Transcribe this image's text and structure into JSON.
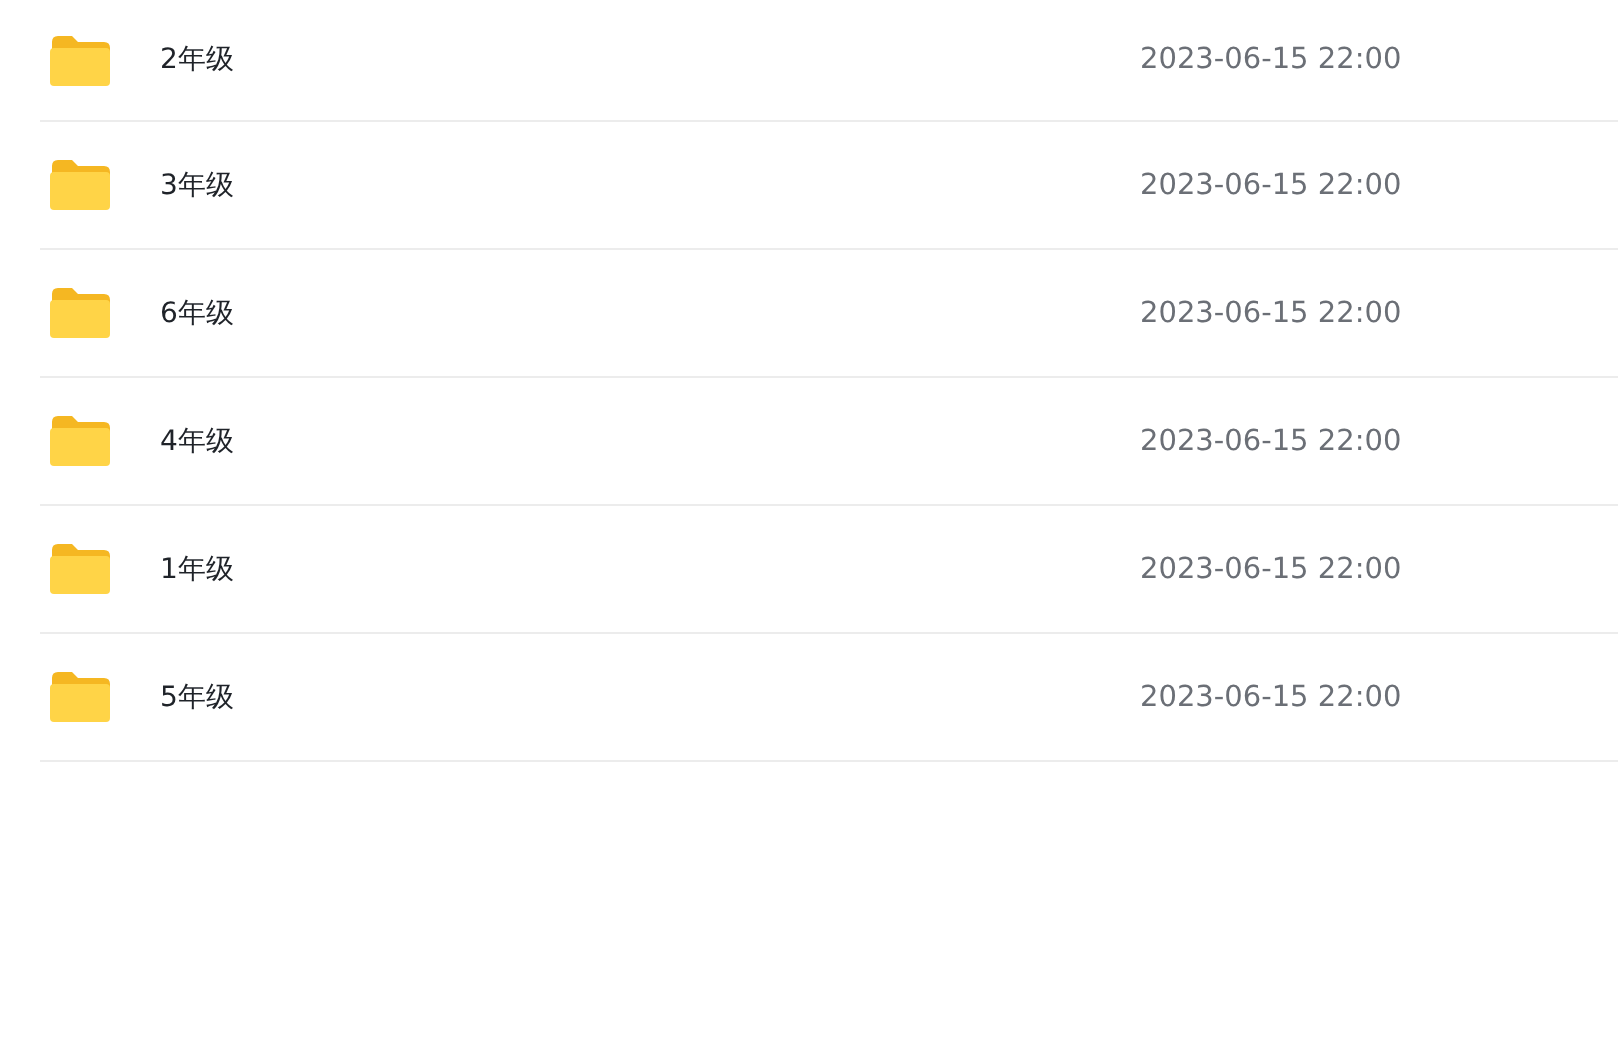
{
  "files": [
    {
      "name": "2年级",
      "modified": "2023-06-15 22:00"
    },
    {
      "name": "3年级",
      "modified": "2023-06-15 22:00"
    },
    {
      "name": "6年级",
      "modified": "2023-06-15 22:00"
    },
    {
      "name": "4年级",
      "modified": "2023-06-15 22:00"
    },
    {
      "name": "1年级",
      "modified": "2023-06-15 22:00"
    },
    {
      "name": "5年级",
      "modified": "2023-06-15 22:00"
    }
  ]
}
